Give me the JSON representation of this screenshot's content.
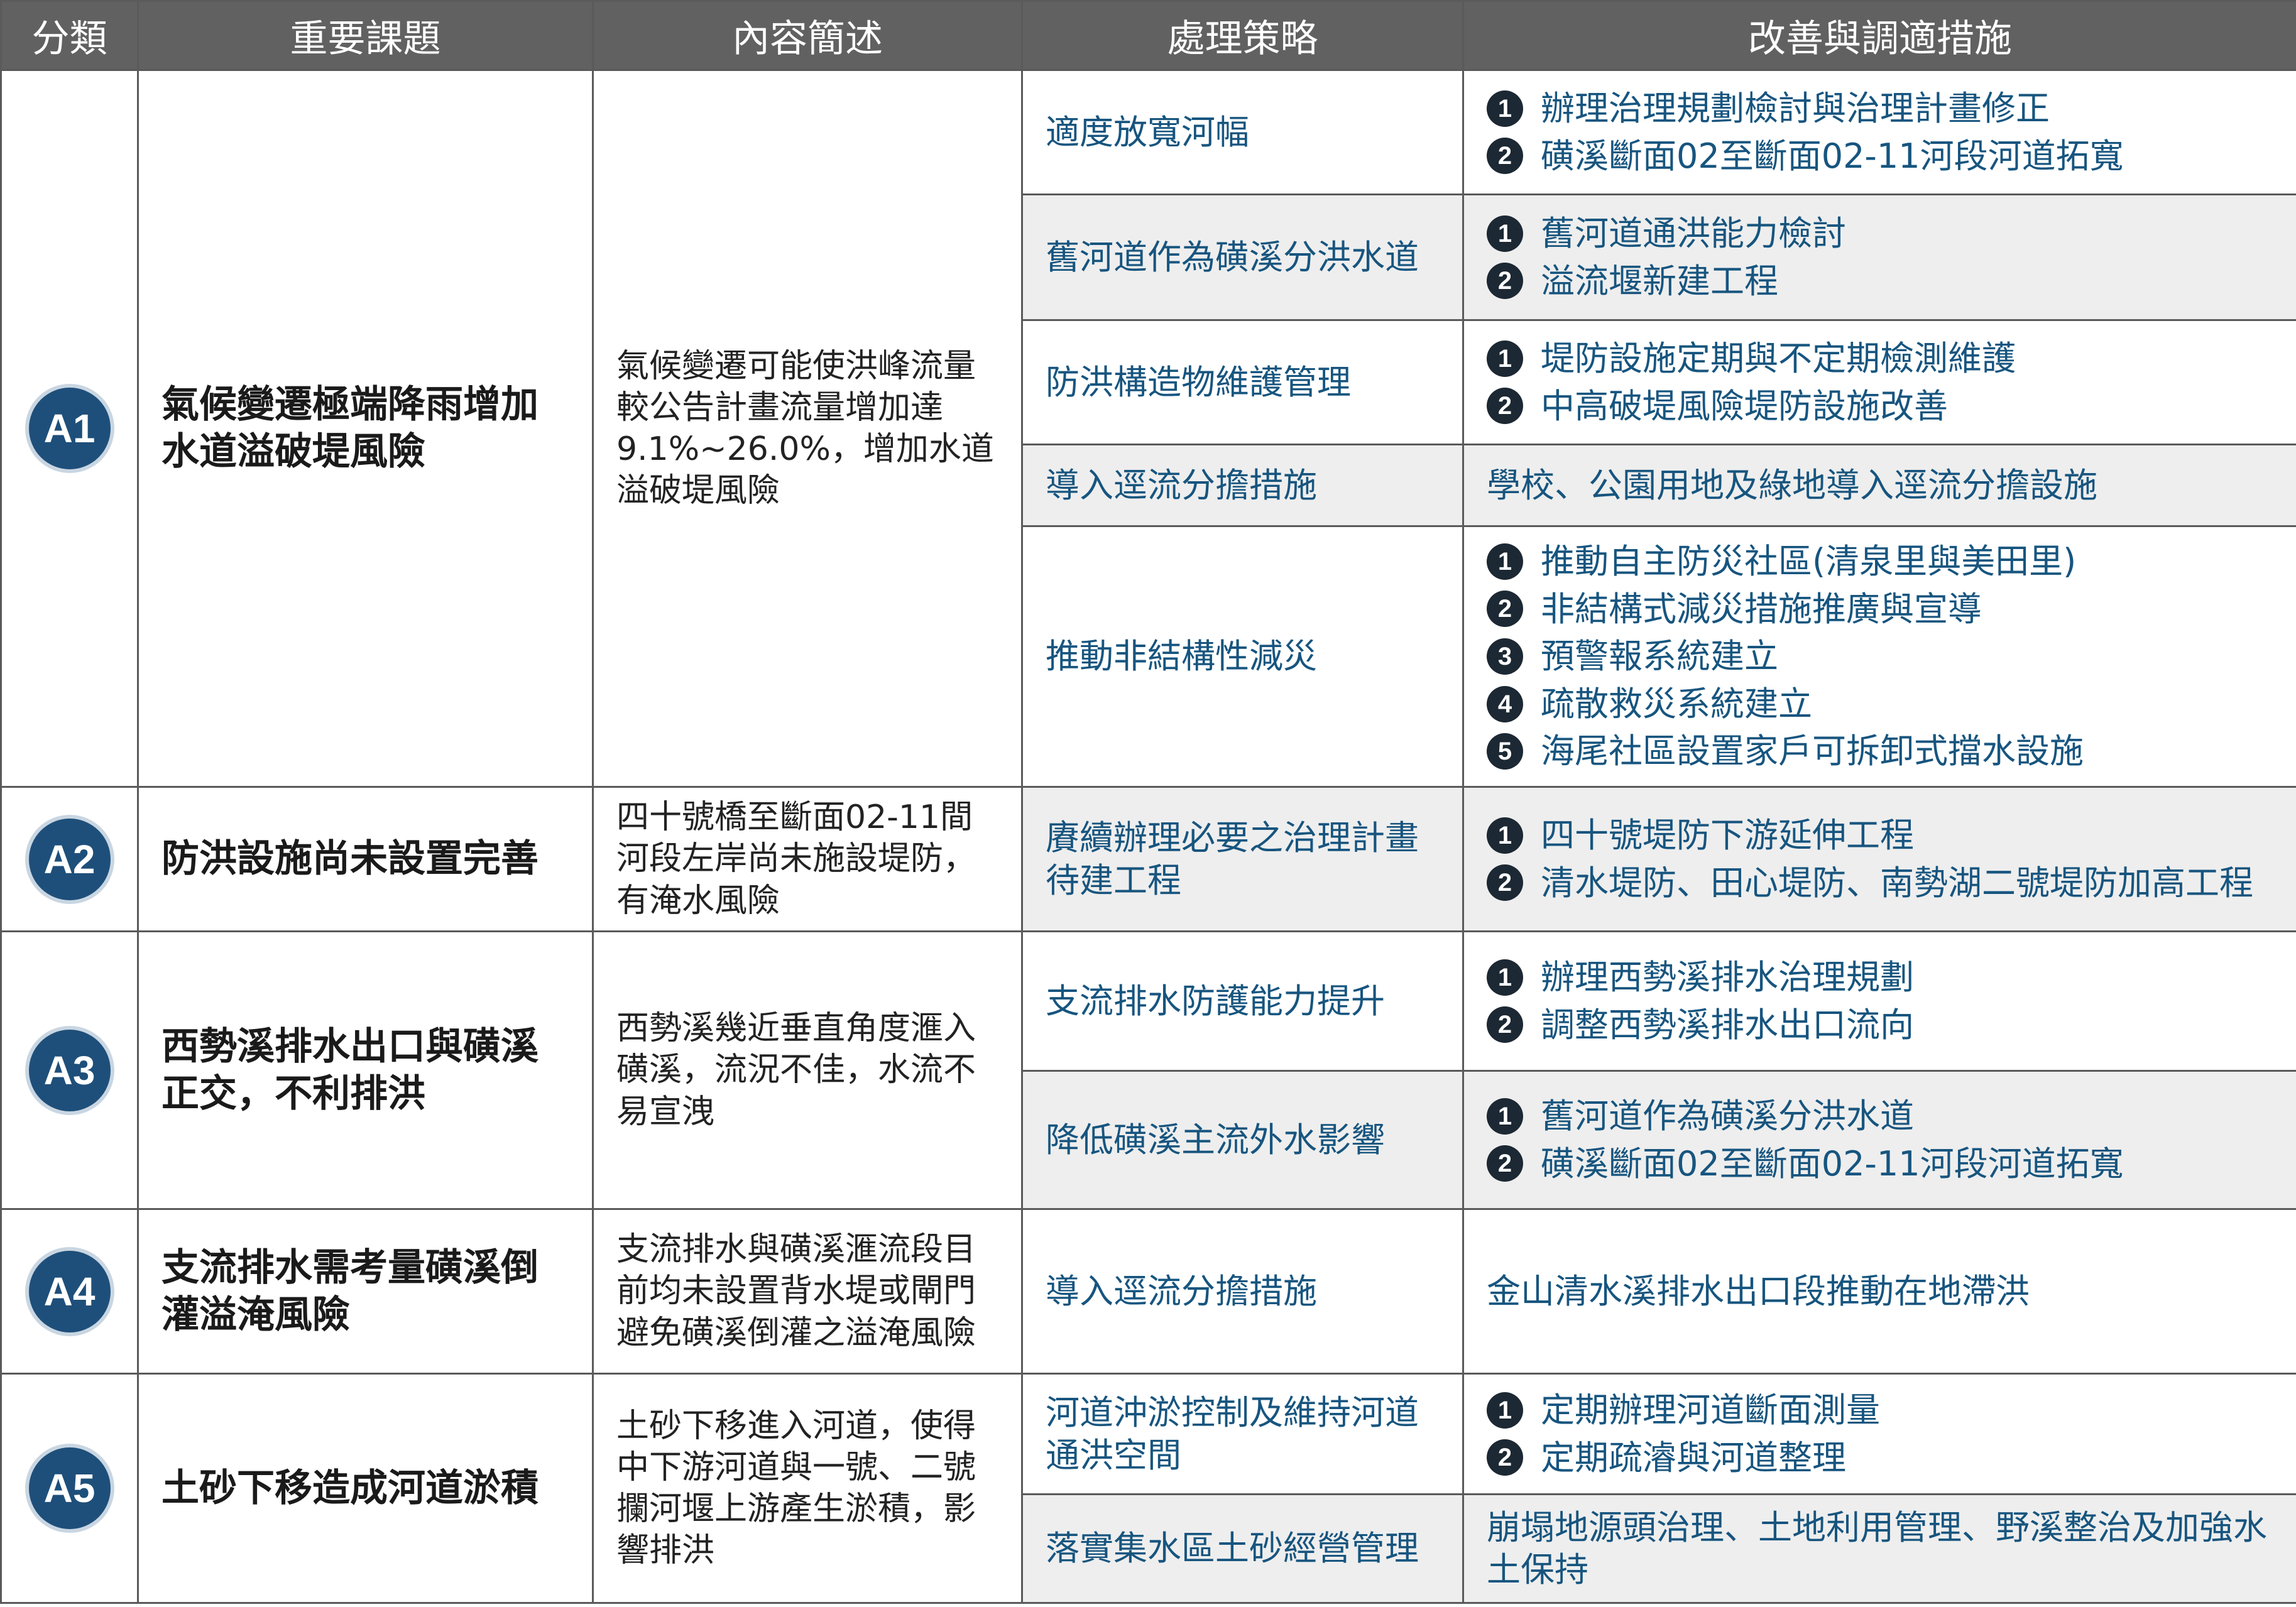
{
  "header": {
    "category": "分類",
    "issue": "重要課題",
    "description": "內容簡述",
    "strategy": "處理策略",
    "measures": "改善與調適措施"
  },
  "groups": [
    {
      "badge": "A1",
      "issue": "氣候變遷極端降雨增加水道溢破堤風險",
      "description": "氣候變遷可能使洪峰流量較公告計畫流量增加達9.1%~26.0%，增加水道溢破堤風險",
      "rows": [
        {
          "strategy": "適度放寬河幅",
          "measures": [
            {
              "num": "1",
              "text": "辦理治理規劃檢討與治理計畫修正"
            },
            {
              "num": "2",
              "text": "磺溪斷面02至斷面02-11河段河道拓寬"
            }
          ]
        },
        {
          "strategy": "舊河道作為磺溪分洪水道",
          "measures": [
            {
              "num": "1",
              "text": "舊河道通洪能力檢討"
            },
            {
              "num": "2",
              "text": "溢流堰新建工程"
            }
          ]
        },
        {
          "strategy": "防洪構造物維護管理",
          "measures": [
            {
              "num": "1",
              "text": "堤防設施定期與不定期檢測維護"
            },
            {
              "num": "2",
              "text": "中高破堤風險堤防設施改善"
            }
          ]
        },
        {
          "strategy": "導入逕流分擔措施",
          "measure_text": "學校、公園用地及綠地導入逕流分擔設施"
        },
        {
          "strategy": "推動非結構性減災",
          "measures": [
            {
              "num": "1",
              "text": "推動自主防災社區(清泉里與美田里)"
            },
            {
              "num": "2",
              "text": "非結構式減災措施推廣與宣導"
            },
            {
              "num": "3",
              "text": "預警報系統建立"
            },
            {
              "num": "4",
              "text": "疏散救災系統建立"
            },
            {
              "num": "5",
              "text": "海尾社區設置家戶可拆卸式擋水設施"
            }
          ]
        }
      ]
    },
    {
      "badge": "A2",
      "issue": "防洪設施尚未設置完善",
      "description": "四十號橋至斷面02-11間河段左岸尚未施設堤防，有淹水風險",
      "rows": [
        {
          "strategy": "賡續辦理必要之治理計畫待建工程",
          "measures": [
            {
              "num": "1",
              "text": "四十號堤防下游延伸工程"
            },
            {
              "num": "2",
              "text": "清水堤防、田心堤防、南勢湖二號堤防加高工程"
            }
          ]
        }
      ]
    },
    {
      "badge": "A3",
      "issue": "西勢溪排水出口與磺溪正交，不利排洪",
      "description": "西勢溪幾近垂直角度滙入磺溪，流況不佳，水流不易宣洩",
      "rows": [
        {
          "strategy": "支流排水防護能力提升",
          "measures": [
            {
              "num": "1",
              "text": "辦理西勢溪排水治理規劃"
            },
            {
              "num": "2",
              "text": "調整西勢溪排水出口流向"
            }
          ]
        },
        {
          "strategy": "降低磺溪主流外水影響",
          "measures": [
            {
              "num": "1",
              "text": "舊河道作為磺溪分洪水道"
            },
            {
              "num": "2",
              "text": "磺溪斷面02至斷面02-11河段河道拓寬"
            }
          ]
        }
      ]
    },
    {
      "badge": "A4",
      "issue": "支流排水需考量磺溪倒灌溢淹風險",
      "description": "支流排水與磺溪滙流段目前均未設置背水堤或閘門避免磺溪倒灌之溢淹風險",
      "rows": [
        {
          "strategy": "導入逕流分擔措施",
          "measure_text": "金山清水溪排水出口段推動在地滯洪"
        }
      ]
    },
    {
      "badge": "A5",
      "issue": "土砂下移造成河道淤積",
      "description": "土砂下移進入河道，使得中下游河道與一號、二號攔河堰上游產生淤積，影響排洪",
      "rows": [
        {
          "strategy": "河道沖淤控制及維持河道通洪空間",
          "measures": [
            {
              "num": "1",
              "text": "定期辦理河道斷面測量"
            },
            {
              "num": "2",
              "text": "定期疏濬與河道整理"
            }
          ]
        },
        {
          "strategy": "落實集水區土砂經營管理",
          "measure_text": "崩塌地源頭治理、土地利用管理、野溪整治及加強水土保持"
        }
      ]
    }
  ]
}
